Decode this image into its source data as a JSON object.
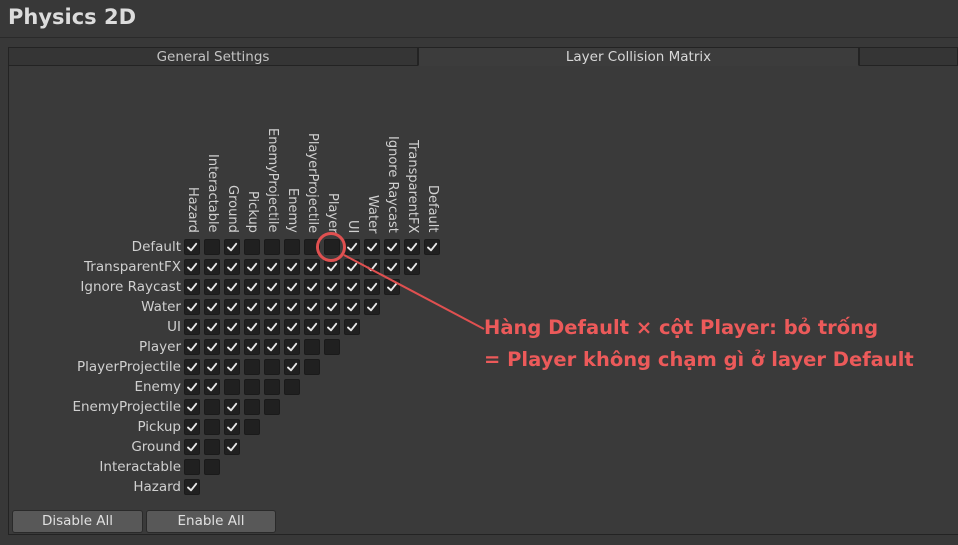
{
  "window": {
    "title": "Physics 2D"
  },
  "tabs": [
    {
      "label": "General Settings",
      "active": false
    },
    {
      "label": "Layer Collision Matrix",
      "active": true
    }
  ],
  "matrix": {
    "row_layers": [
      "Default",
      "TransparentFX",
      "Ignore Raycast",
      "Water",
      "UI",
      "Player",
      "PlayerProjectile",
      "Enemy",
      "EnemyProjectile",
      "Pickup",
      "Ground",
      "Interactable",
      "Hazard"
    ],
    "column_layers": [
      "Hazard",
      "Interactable",
      "Ground",
      "Pickup",
      "EnemyProjectile",
      "Enemy",
      "PlayerProjectile",
      "Player",
      "UI",
      "Water",
      "Ignore Raycast",
      "TransparentFX",
      "Default"
    ],
    "checked": [
      [
        1,
        0,
        1,
        0,
        0,
        0,
        0,
        0,
        1,
        1,
        1,
        1,
        1
      ],
      [
        1,
        1,
        1,
        1,
        1,
        1,
        1,
        1,
        1,
        1,
        1,
        1
      ],
      [
        1,
        1,
        1,
        1,
        1,
        1,
        1,
        1,
        1,
        1,
        1
      ],
      [
        1,
        1,
        1,
        1,
        1,
        1,
        1,
        1,
        1,
        1
      ],
      [
        1,
        1,
        1,
        1,
        1,
        1,
        1,
        1,
        1
      ],
      [
        1,
        1,
        1,
        1,
        1,
        1,
        0,
        0
      ],
      [
        1,
        1,
        1,
        0,
        0,
        1,
        0
      ],
      [
        1,
        1,
        0,
        0,
        0,
        0
      ],
      [
        1,
        0,
        1,
        0,
        0
      ],
      [
        1,
        0,
        1,
        0
      ],
      [
        1,
        0,
        1
      ],
      [
        0,
        0
      ],
      [
        1
      ]
    ]
  },
  "annotation": {
    "color": "#e05050",
    "line1": "Hàng Default × cột Player: bỏ trống",
    "line2": "= Player không chạm gì ở layer Default"
  },
  "buttons": {
    "disable_all": "Disable All",
    "enable_all": "Enable All"
  },
  "colors": {
    "background": "#383838",
    "checkbox": "#202020",
    "accent": "#e05050"
  }
}
